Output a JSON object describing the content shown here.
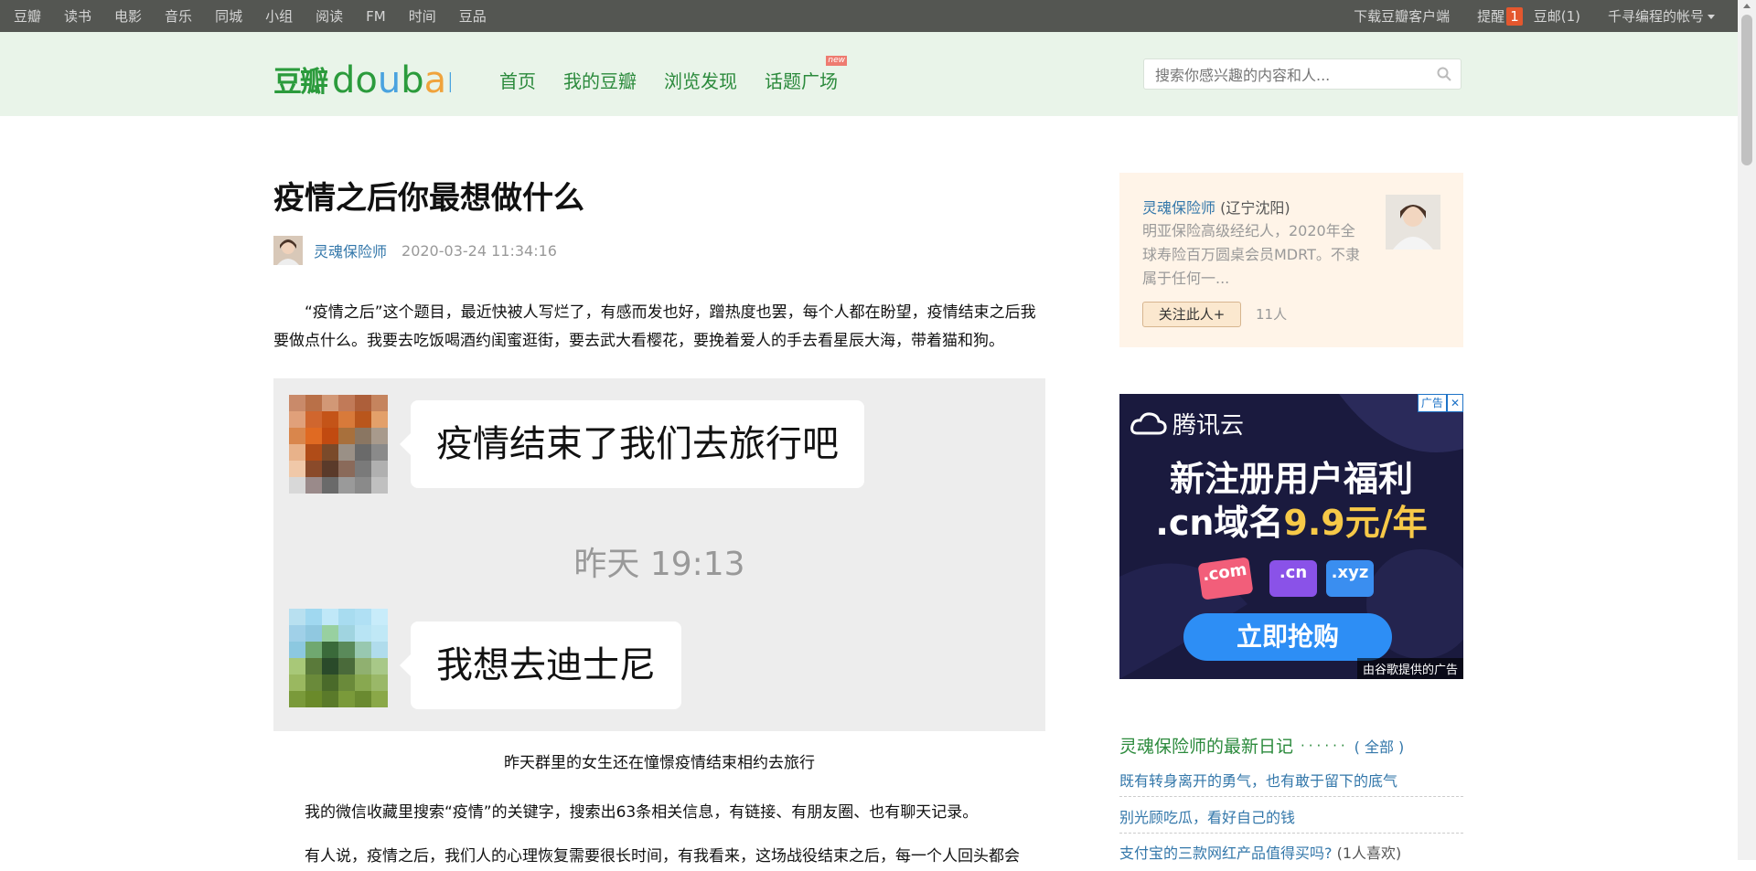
{
  "topbar": {
    "left_items": [
      "豆瓣",
      "读书",
      "电影",
      "音乐",
      "同城",
      "小组",
      "阅读",
      "FM",
      "时间",
      "豆品"
    ],
    "download": "下载豆瓣客户端",
    "remind": "提醒",
    "remind_count": "1",
    "mail": "豆邮(1)",
    "account": "千寻编程的帐号"
  },
  "header": {
    "logo_cn": "豆瓣",
    "logo_en": "douban",
    "nav": [
      "首页",
      "我的豆瓣",
      "浏览发现",
      "话题广场"
    ],
    "new_badge": "new",
    "search_placeholder": "搜索你感兴趣的内容和人..."
  },
  "article": {
    "title": "疫情之后你最想做什么",
    "author": "灵魂保险师",
    "date": "2020-03-24 11:34:16",
    "paragraph1": "“疫情之后”这个题目，最近快被人写烂了，有感而发也好，蹭热度也罢，每个人都在盼望，疫情结束之后我要做点什么。我要去吃饭喝酒约闺蜜逛街，要去武大看樱花，要挽着爱人的手去看星辰大海，带着猫和狗。",
    "chat": {
      "msg1": "疫情结束了我们去旅行吧",
      "time": "昨天 19:13",
      "msg2": "我想去迪士尼"
    },
    "caption": "昨天群里的女生还在憧憬疫情结束相约去旅行",
    "paragraph2": "我的微信收藏里搜索“疫情”的关键字，搜索出63条相关信息，有链接、有朋友圈、也有聊天记录。",
    "paragraph3": "有人说，疫情之后，我们人的心理恢复需要很长时间，有我看来，这场战役结束之后，每一个人回头都会"
  },
  "sidebar": {
    "profile": {
      "name": "灵魂保险师",
      "location": "(辽宁沈阳)",
      "desc": "明亚保险高级经纪人，2020年全球寿险百万圆桌会员MDRT。不隶属于任何一...",
      "follow": "关注此人+",
      "followers": "11人"
    },
    "ad": {
      "brand": "腾讯云",
      "line1": "新注册用户福利",
      "line2_prefix": ".cn域名",
      "line2_price": "9.9元/年",
      "chips": [
        ".com",
        ".cn",
        ".xyz"
      ],
      "button": "立即抢购",
      "label": "广告",
      "footer": "由谷歌提供的广告"
    },
    "diary": {
      "heading": "灵魂保险师的最新日记",
      "dots": "······",
      "all": "( 全部 )",
      "items": [
        {
          "title": "既有转身离开的勇气，也有敢于留下的底气",
          "likes": ""
        },
        {
          "title": "别光顾吃瓜，看好自己的钱",
          "likes": ""
        },
        {
          "title": "支付宝的三款网红产品值得买吗?",
          "likes": "(1人喜欢)"
        }
      ]
    }
  },
  "colors": {
    "topbar": "#545652",
    "header": "#e9f4e9",
    "brand_green": "#2b8a3c",
    "link_blue": "#3377aa"
  }
}
